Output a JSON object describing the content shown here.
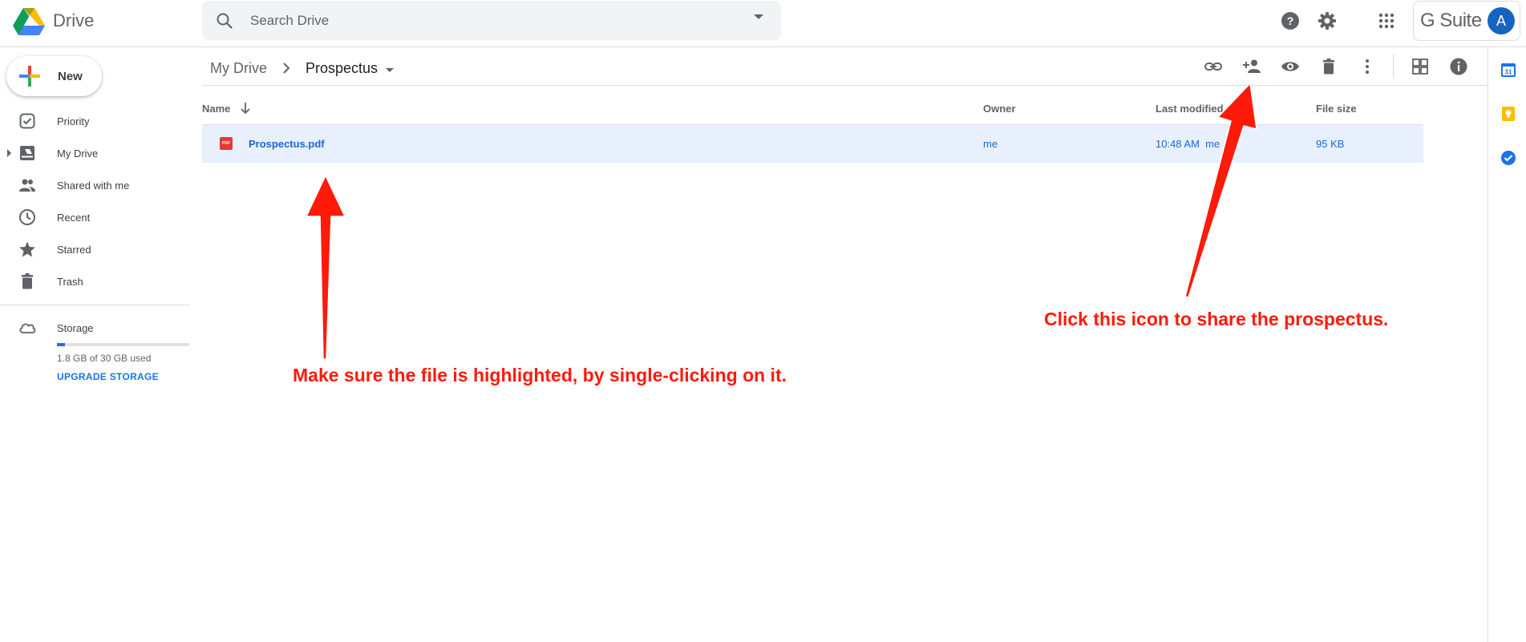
{
  "app": {
    "title": "Drive"
  },
  "search": {
    "placeholder": "Search Drive"
  },
  "header": {
    "gsuite_label": "G Suite",
    "avatar_initial": "A"
  },
  "sidebar": {
    "new_label": "New",
    "items": [
      {
        "label": "Priority",
        "icon": "priority-icon"
      },
      {
        "label": "My Drive",
        "icon": "my-drive-icon"
      },
      {
        "label": "Shared with me",
        "icon": "shared-icon"
      },
      {
        "label": "Recent",
        "icon": "clock-icon"
      },
      {
        "label": "Starred",
        "icon": "star-icon"
      },
      {
        "label": "Trash",
        "icon": "trash-icon"
      }
    ],
    "storage": {
      "label": "Storage",
      "usage_text": "1.8 GB of 30 GB used",
      "used_fraction": 0.06,
      "upgrade_label": "UPGRADE STORAGE"
    }
  },
  "breadcrumb": {
    "root": "My Drive",
    "current": "Prospectus"
  },
  "table": {
    "columns": {
      "name": "Name",
      "owner": "Owner",
      "modified": "Last modified",
      "size": "File size"
    },
    "rows": [
      {
        "icon_text": "PDF",
        "name": "Prospectus.pdf",
        "owner": "me",
        "modified": "10:48 AM  me",
        "size": "95 KB"
      }
    ]
  },
  "annotations": {
    "highlight_note": "Make sure the file is highlighted, by single-clicking on it.",
    "share_note": "Click this icon to share the prospectus."
  },
  "colors": {
    "accent": "#1a73e8",
    "selected_row": "#e8f0fe",
    "annotation": "#ff1a0a",
    "avatar": "#1565c0"
  }
}
